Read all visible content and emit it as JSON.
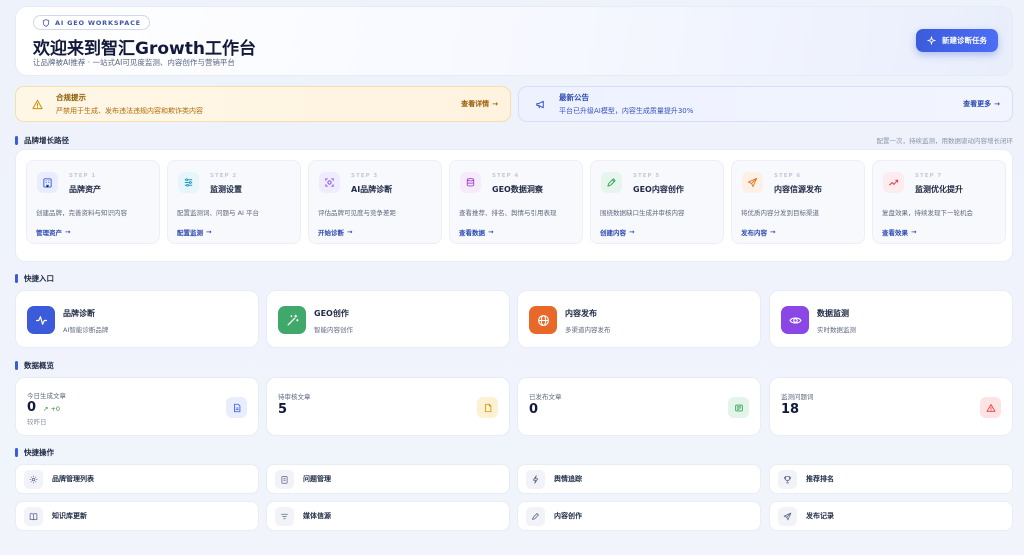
{
  "hero": {
    "badge": "AI GEO WORKSPACE",
    "title": "欢迎来到智汇Growth工作台",
    "subtitle": "让品牌被AI推荐 · 一站式AI可见度监测、内容创作与营销平台",
    "cta": "新建诊断任务"
  },
  "notices": {
    "warn": {
      "title": "合规提示",
      "desc": "严禁用于生成、发布违法违规内容和欺诈类内容",
      "link": "查看详情"
    },
    "info": {
      "title": "最新公告",
      "desc": "平台已升级AI模型，内容生成质量提升30%",
      "link": "查看更多"
    }
  },
  "growth": {
    "title": "品牌增长路径",
    "note": "配置一次，持续监测，用数据驱动内容增长闭环",
    "steps": [
      {
        "no": "STEP 1",
        "title": "品牌资产",
        "desc": "创建品牌，完善资料与知识内容",
        "link": "管理资产",
        "icon": "building-icon"
      },
      {
        "no": "STEP 2",
        "title": "监测设置",
        "desc": "配置监测词、问题与 AI 平台",
        "link": "配置监测",
        "icon": "sliders-icon"
      },
      {
        "no": "STEP 3",
        "title": "AI品牌诊断",
        "desc": "评估品牌可见度与竞争差距",
        "link": "开始诊断",
        "icon": "scan-icon"
      },
      {
        "no": "STEP 4",
        "title": "GEO数据洞察",
        "desc": "查看推荐、排名、舆情与引用表现",
        "link": "查看数据",
        "icon": "database-icon"
      },
      {
        "no": "STEP 5",
        "title": "GEO内容创作",
        "desc": "围绕数据缺口生成并审核内容",
        "link": "创建内容",
        "icon": "pen-icon"
      },
      {
        "no": "STEP 6",
        "title": "内容信源发布",
        "desc": "将优质内容分发到目标渠道",
        "link": "发布内容",
        "icon": "send-icon"
      },
      {
        "no": "STEP 7",
        "title": "监测优化提升",
        "desc": "复盘效果，持续发现下一轮机会",
        "link": "查看效果",
        "icon": "trend-icon"
      }
    ]
  },
  "quick_entry": {
    "title": "快捷入口",
    "items": [
      {
        "title": "品牌诊断",
        "desc": "AI智能诊断品牌",
        "icon": "pulse-icon",
        "color": "#3b5bdb"
      },
      {
        "title": "GEO创作",
        "desc": "智能内容创作",
        "icon": "magic-wand-icon",
        "color": "#40a86b"
      },
      {
        "title": "内容发布",
        "desc": "多渠道内容发布",
        "icon": "globe-icon",
        "color": "#e8682a"
      },
      {
        "title": "数据监测",
        "desc": "实时数据监测",
        "icon": "eye-icon",
        "color": "#8b47e6"
      }
    ]
  },
  "overview": {
    "title": "数据概览",
    "stats": [
      {
        "label": "今日生成文章",
        "value": "0",
        "trend": "+0",
        "sub": "较昨日",
        "icon": "document-icon"
      },
      {
        "label": "待审核文章",
        "value": "5",
        "icon": "file-icon"
      },
      {
        "label": "已发布文章",
        "value": "0",
        "icon": "newspaper-icon"
      },
      {
        "label": "监测问题词",
        "value": "18",
        "icon": "alert-icon"
      }
    ]
  },
  "ops": {
    "title": "快捷操作",
    "items": [
      {
        "label": "品牌管理列表",
        "icon": "gear-icon"
      },
      {
        "label": "问题管理",
        "icon": "clipboard-icon"
      },
      {
        "label": "舆情追踪",
        "icon": "bolt-icon"
      },
      {
        "label": "推荐排名",
        "icon": "trophy-icon"
      },
      {
        "label": "知识库更新",
        "icon": "book-icon"
      },
      {
        "label": "媒体信源",
        "icon": "filter-icon"
      },
      {
        "label": "内容创作",
        "icon": "pen-icon"
      },
      {
        "label": "发布记录",
        "icon": "send-icon"
      }
    ]
  }
}
